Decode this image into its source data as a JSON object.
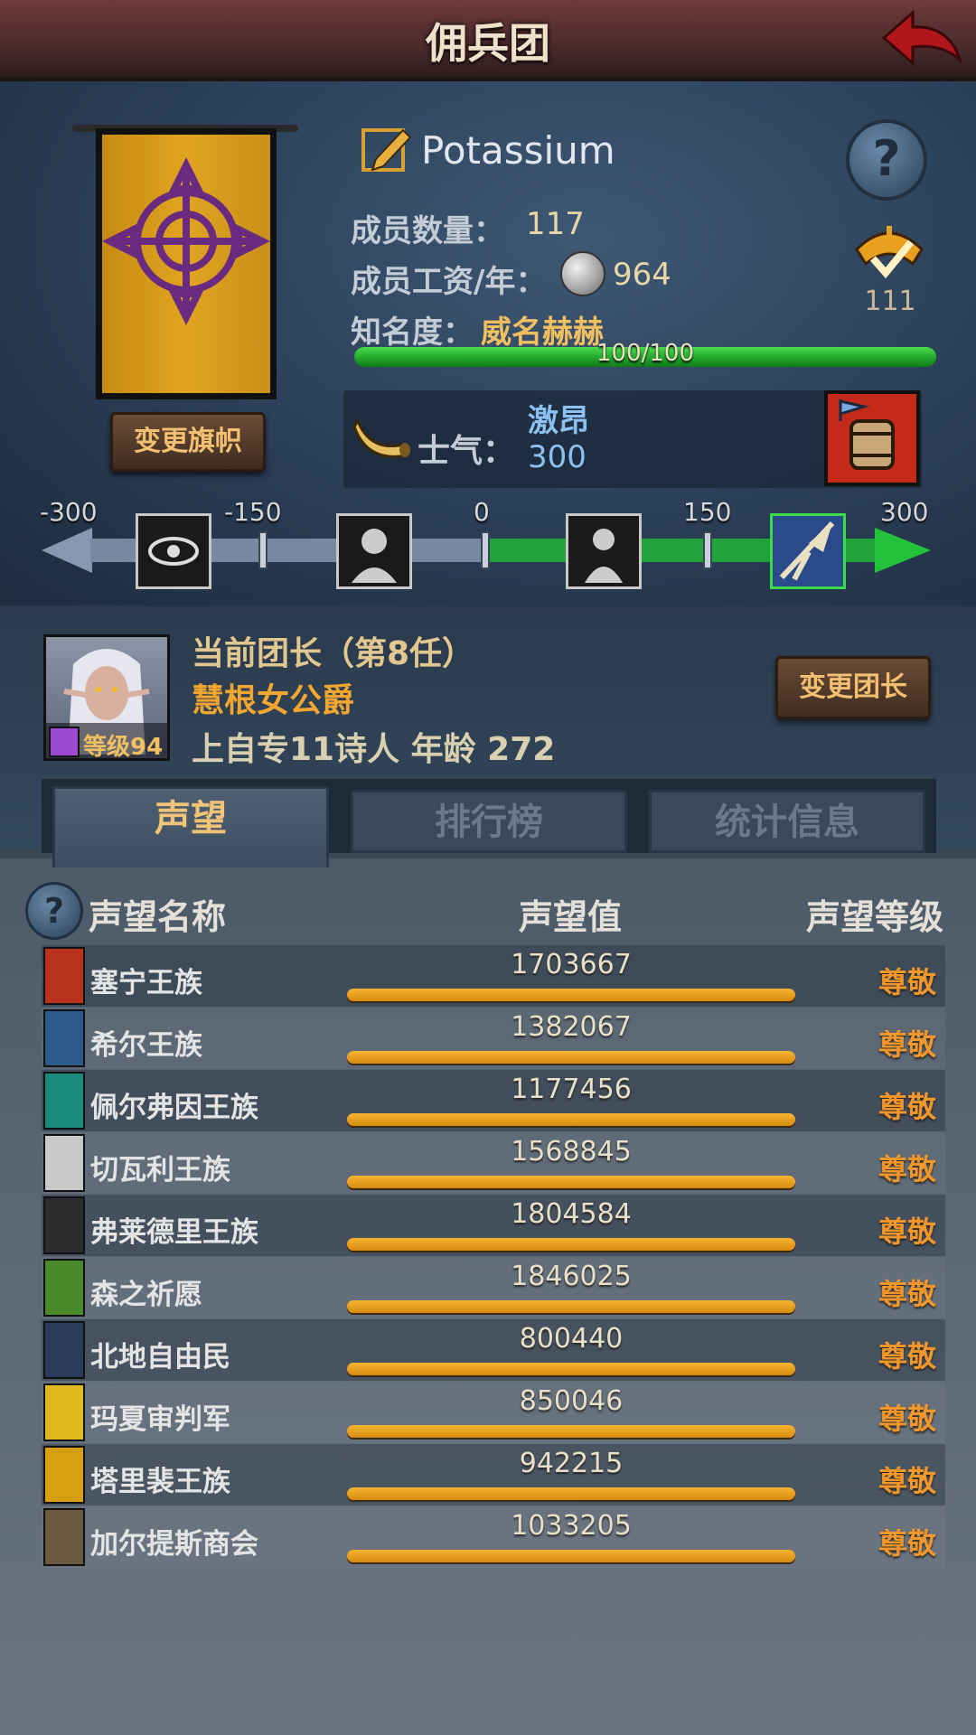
{
  "header": {
    "title": "佣兵团"
  },
  "guild": {
    "name": "Potassium",
    "members_label": "成员数量：",
    "members_value": "117",
    "wage_label": "成员工资/年：",
    "wage_value": "964",
    "fame_label": "知名度：",
    "fame_value": "威名赫赫",
    "fame_progress_text": "100/100",
    "fame_progress": 1.0,
    "emblem_count": "111",
    "change_banner_label": "变更旗帜",
    "help_label": "?"
  },
  "morale": {
    "label": "士气：",
    "word": "激昂",
    "value": "300",
    "scale_labels": [
      "-300",
      "-150",
      "0",
      "150",
      "300"
    ]
  },
  "leader": {
    "title": "当前团长（第8任）",
    "name": "慧根女公爵",
    "origin": "上自专11诗人 年龄 272",
    "level": "等级94",
    "change_leader_label": "变更团长"
  },
  "tabs": [
    {
      "label": "声望",
      "active": true
    },
    {
      "label": "排行榜",
      "active": false
    },
    {
      "label": "统计信息",
      "active": false
    }
  ],
  "table": {
    "help_label": "?",
    "headers": {
      "name": "声望名称",
      "value": "声望值",
      "rank": "声望等级"
    },
    "rows": [
      {
        "name": "塞宁王族",
        "value": "1703667",
        "rank": "尊敬",
        "color": "#b8321e"
      },
      {
        "name": "希尔王族",
        "value": "1382067",
        "rank": "尊敬",
        "color": "#2c5a8a"
      },
      {
        "name": "佩尔弗因王族",
        "value": "1177456",
        "rank": "尊敬",
        "color": "#1a8a7a"
      },
      {
        "name": "切瓦利王族",
        "value": "1568845",
        "rank": "尊敬",
        "color": "#c8c8c8"
      },
      {
        "name": "弗莱德里王族",
        "value": "1804584",
        "rank": "尊敬",
        "color": "#2c2c2c"
      },
      {
        "name": "森之祈愿",
        "value": "1846025",
        "rank": "尊敬",
        "color": "#4a8a2a"
      },
      {
        "name": "北地自由民",
        "value": "800440",
        "rank": "尊敬",
        "color": "#2a3a5a"
      },
      {
        "name": "玛夏审判军",
        "value": "850046",
        "rank": "尊敬",
        "color": "#e0b820"
      },
      {
        "name": "塔里裴王族",
        "value": "942215",
        "rank": "尊敬",
        "color": "#d8a010"
      },
      {
        "name": "加尔提斯商会",
        "value": "1033205",
        "rank": "尊敬",
        "color": "#6a5a40"
      }
    ]
  }
}
